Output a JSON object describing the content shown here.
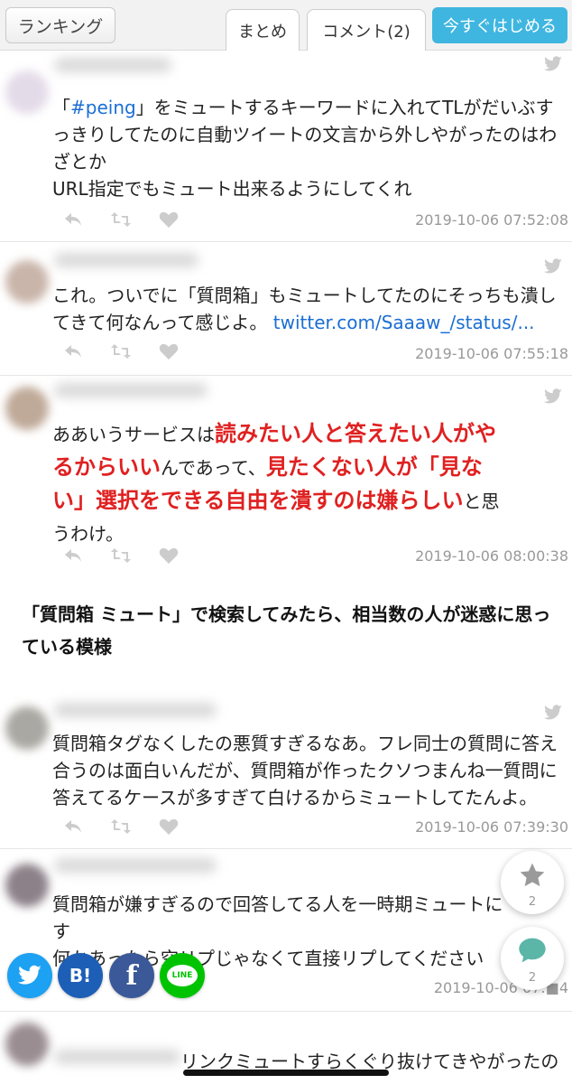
{
  "header": {
    "ranking_label": "ランキング",
    "tab_matome": "まとめ",
    "tab_comment": "コメント(2)",
    "start_label": "今すぐはじめる",
    "accent_color": "#3fb6e0"
  },
  "tweets": [
    {
      "text_lines": [
        "「#peing」をミュートするキーワードに入れてTLがだいぶす",
        "っきりしてたのに自動ツイートの文言から外しやがったのはわ",
        "ざとか",
        "URL指定でもミュート出来るようにしてくれ"
      ],
      "hashtag": "#peing",
      "timestamp": "2019-10-06 07:52:08"
    },
    {
      "text_line1": "これ。ついでに「質問箱」もミュートしてたのにそっちも潰し",
      "text_line2": "てきて何なんって感じよ。",
      "link": "twitter.com/Saaaw_/status/...",
      "timestamp": "2019-10-06 07:55:18"
    },
    {
      "seg1": "ああいうサービスは",
      "seg2": "読みたい人と答えたい人がや",
      "seg3": "るからいい",
      "seg4": "んであって、",
      "seg5": "見たくない人が「見な",
      "seg6": "い」選択をできる自由を潰すのは嫌らしい",
      "seg7": "と思",
      "seg8": "うわけ。",
      "timestamp": "2019-10-06 08:00:38"
    },
    {
      "text_lines": [
        "質問箱タグなくしたの悪質すぎるなあ。フレ同士の質問に答え",
        "合うのは面白いんだが、質問箱が作ったクソつまんね一質問に",
        "答えてるケースが多すぎて白けるからミュートしてたんよ。"
      ],
      "timestamp": "2019-10-06 07:39:30"
    },
    {
      "text_lines": [
        "質問箱が嫌すぎるので回答してる人を一時期ミュートに",
        "す",
        "何かあったら空リプじゃなくて直接リプしてください"
      ],
      "timestamp": "2019-10-06 07:■4"
    },
    {
      "text_line1": "リンクミュートすらくぐり抜けてきやがったの"
    }
  ],
  "section_heading": "「質問箱 ミュート」で検索してみたら、相当数の人が迷惑に思っている模様",
  "floating": {
    "favorite_count": "2",
    "comment_count": "2"
  },
  "share": {
    "hatena_label": "B!",
    "facebook_label": "f",
    "line_label": "LINE"
  },
  "icons": [
    "twitter-bird-icon",
    "reply-icon",
    "retweet-icon",
    "like-icon",
    "star-icon",
    "comment-bubble-icon"
  ]
}
